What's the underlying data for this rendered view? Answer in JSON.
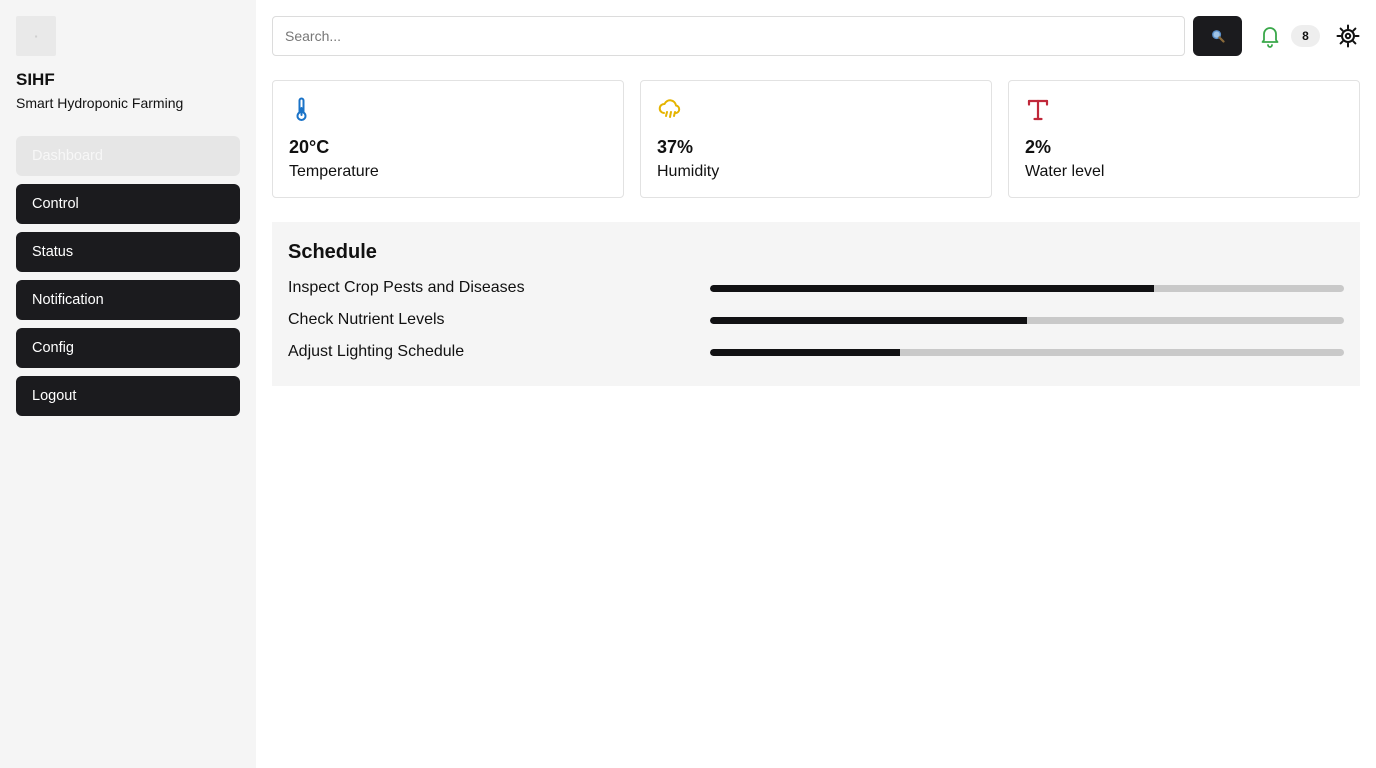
{
  "brand": {
    "logo_alt": "",
    "title": "SIHF",
    "subtitle": "Smart Hydroponic Farming"
  },
  "nav": [
    {
      "label": "Dashboard",
      "active": true
    },
    {
      "label": "Control",
      "active": false
    },
    {
      "label": "Status",
      "active": false
    },
    {
      "label": "Notification",
      "active": false
    },
    {
      "label": "Config",
      "active": false
    },
    {
      "label": "Logout",
      "active": false
    }
  ],
  "topbar": {
    "search_placeholder": "Search...",
    "search_icon": "magnifier-icon",
    "notification_icon": "bell-icon",
    "notification_count": "8",
    "settings_icon": "gear-icon"
  },
  "sensors": [
    {
      "icon": "thermometer-icon",
      "color": "#1a73c8",
      "value": "20°C",
      "label": "Temperature"
    },
    {
      "icon": "cloud-rain-icon",
      "color": "#e5b400",
      "value": "37%",
      "label": "Humidity"
    },
    {
      "icon": "water-level-icon",
      "color": "#c0283a",
      "value": "2%",
      "label": "Water level"
    }
  ],
  "schedule": {
    "title": "Schedule",
    "tasks": [
      {
        "name": "Inspect Crop Pests and Diseases",
        "progress": 0.7
      },
      {
        "name": "Check Nutrient Levels",
        "progress": 0.5
      },
      {
        "name": "Adjust Lighting Schedule",
        "progress": 0.3
      }
    ]
  },
  "colors": {
    "accent_dark": "#1b1b1e",
    "bell": "#3aa84a",
    "sidebar_bg": "#f5f5f5"
  }
}
